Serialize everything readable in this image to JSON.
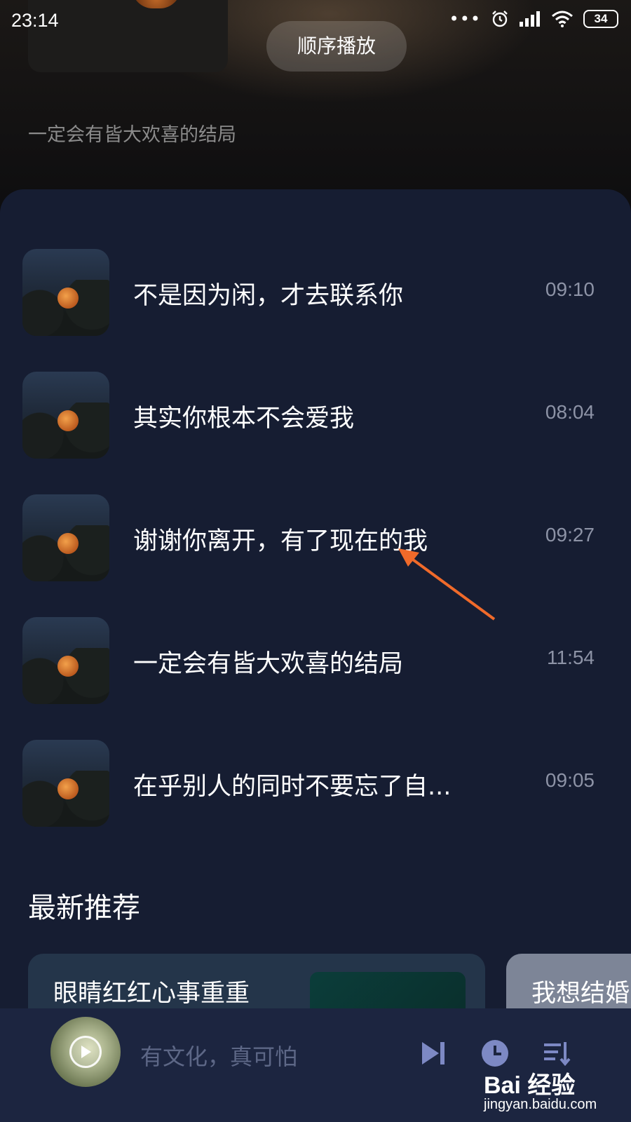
{
  "status_bar": {
    "time": "23:14",
    "dots": "•••",
    "battery": "34"
  },
  "header": {
    "play_mode_label": "顺序播放",
    "playlist_description": "一定会有皆大欢喜的结局"
  },
  "songs": [
    {
      "title": "不是因为闲，才去联系你",
      "duration": "09:10"
    },
    {
      "title": "其实你根本不会爱我",
      "duration": "08:04"
    },
    {
      "title": "谢谢你离开，有了现在的我",
      "duration": "09:27"
    },
    {
      "title": "一定会有皆大欢喜的结局",
      "duration": "11:54"
    },
    {
      "title": "在乎别人的同时不要忘了自...",
      "duration": "09:05"
    }
  ],
  "recommend": {
    "section_title": "最新推荐",
    "cards": [
      {
        "title": "眼睛红红心事重重"
      },
      {
        "title": "我想结婚"
      }
    ]
  },
  "mini_player": {
    "title": "有文化，真可怕"
  },
  "watermark": {
    "logo": "Bai 经验",
    "url": "jingyan.baidu.com"
  },
  "colors": {
    "panel": "#161d32",
    "mini_player": "#1c2540",
    "arrow": "#f06a2a"
  }
}
